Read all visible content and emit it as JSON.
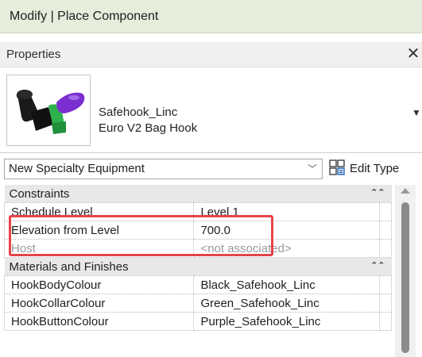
{
  "ribbon": {
    "title": "Modify | Place Component"
  },
  "properties_panel": {
    "title": "Properties",
    "close_icon": "close-icon",
    "type_selector": {
      "family": "Safehook_Linc",
      "type": "Euro V2 Bag Hook",
      "thumbnail_icon": "bag-hook-icon"
    },
    "category_filter": "New Specialty Equipment",
    "edit_type_label": "Edit Type",
    "groups": [
      {
        "name": "Constraints",
        "rows": [
          {
            "label": "Schedule Level",
            "value": "Level 1",
            "dimmed": false
          },
          {
            "label": "Elevation from Level",
            "value": "700.0",
            "dimmed": false
          },
          {
            "label": "Host",
            "value": "<not associated>",
            "dimmed": true
          }
        ]
      },
      {
        "name": "Materials and Finishes",
        "rows": [
          {
            "label": "HookBodyColour",
            "value": "Black_Safehook_Linc",
            "dimmed": false
          },
          {
            "label": "HookCollarColour",
            "value": "Green_Safehook_Linc",
            "dimmed": false
          },
          {
            "label": "HookButtonColour",
            "value": "Purple_Safehook_Linc",
            "dimmed": false
          }
        ]
      }
    ]
  },
  "colors": {
    "ribbon_bg": "#e4eedb",
    "highlight": "#e8434a",
    "hook_body": "#1a1a1a",
    "hook_collar": "#2bb24c",
    "hook_button": "#7b2fd0"
  }
}
